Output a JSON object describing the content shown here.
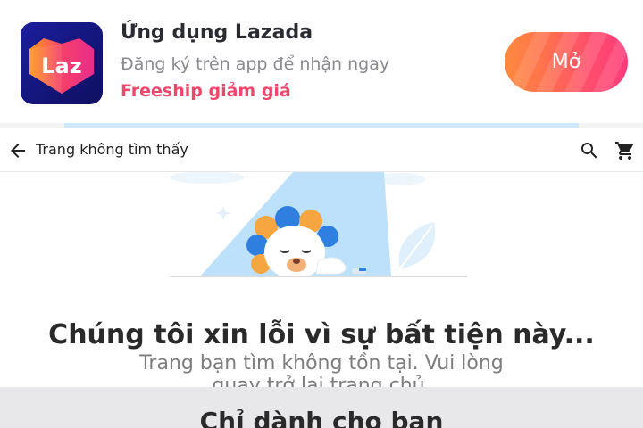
{
  "banner": {
    "app_name": "Ứng dụng Lazada",
    "subtitle": "Đăng ký trên app để nhận ngay",
    "promo": "Freeship giảm giá",
    "open_label": "Mở",
    "logo_text": "Laz",
    "colors": {
      "promo": "#f0466c",
      "button_start": "#ff8a3d",
      "button_end": "#ff3a7a",
      "icon_bg": "#131577"
    }
  },
  "navbar": {
    "title": "Trang không tìm thấy",
    "icons": [
      "arrow-back-icon",
      "search-icon",
      "cart-icon"
    ]
  },
  "error": {
    "title": "Chúng tôi xin lỗi vì sự bất tiện này...",
    "description": "Trang bạn tìm không tồn tại. Vui lòng quay trở lại trang chủ."
  },
  "for_you": {
    "title": "Chỉ dành cho bạn"
  }
}
